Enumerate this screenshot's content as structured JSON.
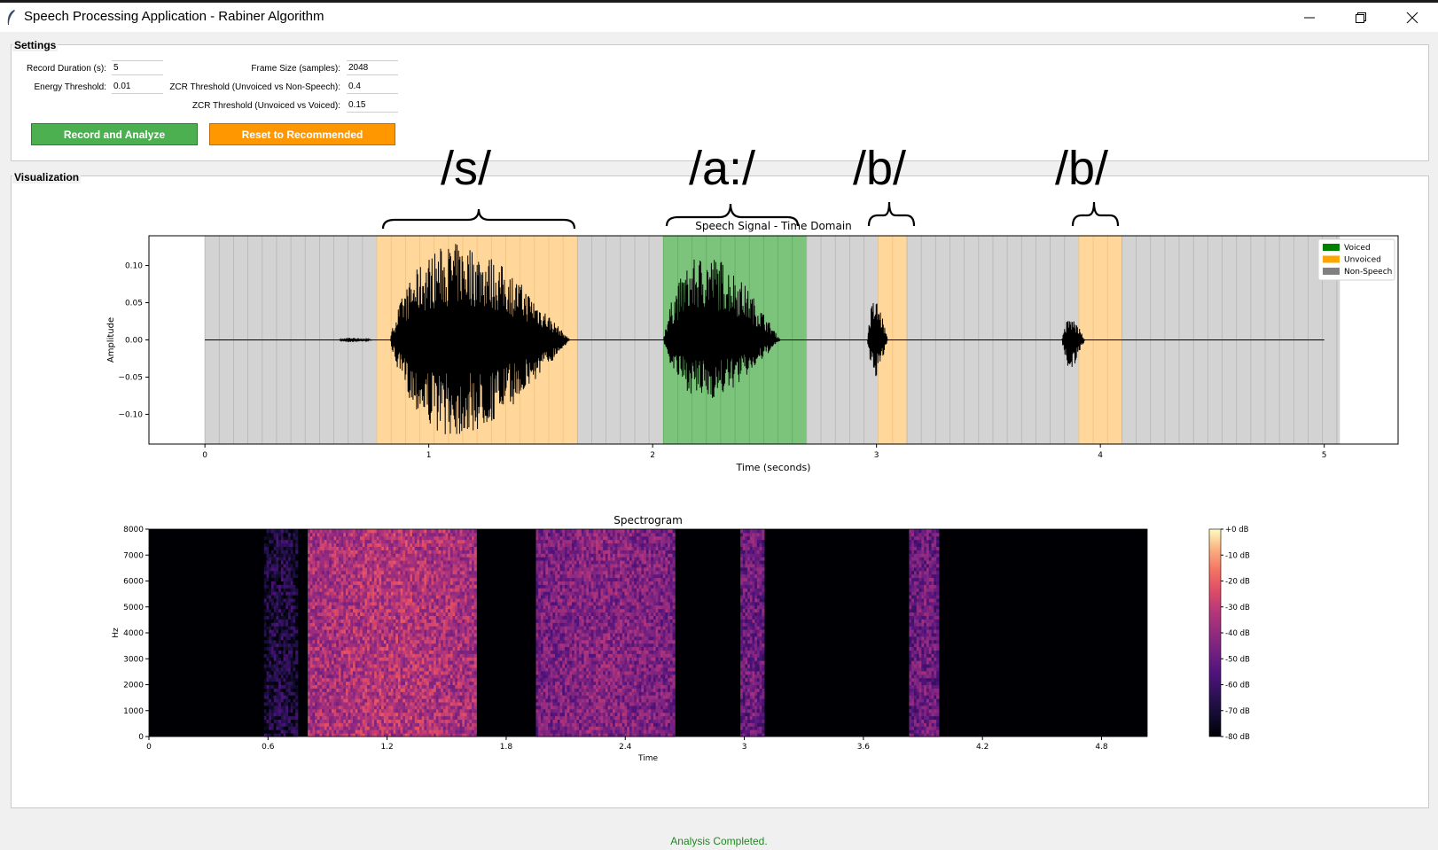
{
  "window": {
    "title": "Speech Processing Application - Rabiner Algorithm",
    "controls": [
      "minimize-icon",
      "restore-icon",
      "close-icon"
    ]
  },
  "settings": {
    "group_label": "Settings",
    "fields": {
      "record_duration": {
        "label": "Record Duration (s):",
        "value": "5"
      },
      "frame_size": {
        "label": "Frame Size (samples):",
        "value": "2048"
      },
      "energy_threshold": {
        "label": "Energy Threshold:",
        "value": "0.01"
      },
      "zcr_unvoiced_nonspeech": {
        "label": "ZCR Threshold (Unvoiced vs Non-Speech):",
        "value": "0.4"
      },
      "zcr_unvoiced_voiced": {
        "label": "ZCR Threshold (Unvoiced vs Voiced):",
        "value": "0.15"
      }
    },
    "buttons": {
      "record": "Record and Analyze",
      "reset": "Reset to Recommended"
    }
  },
  "visualization": {
    "group_label": "Visualization",
    "annotations": [
      "/s/",
      "/a:/",
      "/b/",
      "/b/"
    ]
  },
  "status": "Analysis Completed.",
  "colors": {
    "voiced": "#008000",
    "unvoiced": "#ffa500",
    "non_speech": "#808080",
    "record_button": "#4caf50",
    "reset_button": "#ff9800",
    "status_text": "#1e8a1e"
  },
  "chart_data": [
    {
      "type": "line",
      "title": "Speech Signal - Time Domain",
      "xlabel": "Time (seconds)",
      "ylabel": "Amplitude",
      "xlim": [
        -0.25,
        5.33
      ],
      "ylim": [
        -0.14,
        0.14
      ],
      "xticks": [
        0,
        1,
        2,
        3,
        4,
        5
      ],
      "yticks": [
        0.1,
        0.05,
        0.0,
        -0.05,
        -0.1
      ],
      "ytick_labels": [
        "0.10",
        "0.05",
        "0.00",
        "−0.05",
        "−0.10"
      ],
      "legend": {
        "position": "top-right",
        "entries": [
          {
            "label": "Voiced",
            "color": "#008000"
          },
          {
            "label": "Unvoiced",
            "color": "#ffa500"
          },
          {
            "label": "Non-Speech",
            "color": "#808080"
          }
        ]
      },
      "frame_span": [
        0,
        5.07
      ],
      "frame_step": 0.064,
      "segments": [
        {
          "class": "Unvoiced",
          "start": 0.79,
          "end": 1.65
        },
        {
          "class": "Voiced",
          "start": 2.04,
          "end": 2.7
        },
        {
          "class": "Unvoiced",
          "start": 3.03,
          "end": 3.16
        },
        {
          "class": "Unvoiced",
          "start": 3.88,
          "end": 4.08
        }
      ],
      "bursts": [
        {
          "start": 0.6,
          "end": 0.75,
          "amp_pos": 0.003,
          "amp_neg": 0.003
        },
        {
          "start": 0.83,
          "end": 1.63,
          "amp_pos": 0.13,
          "amp_neg": 0.13
        },
        {
          "start": 2.05,
          "end": 2.57,
          "amp_pos": 0.115,
          "amp_neg": 0.08
        },
        {
          "start": 2.96,
          "end": 3.05,
          "amp_pos": 0.055,
          "amp_neg": 0.05
        },
        {
          "start": 3.83,
          "end": 3.93,
          "amp_pos": 0.03,
          "amp_neg": 0.04
        }
      ]
    },
    {
      "type": "heatmap",
      "title": "Spectrogram",
      "xlabel": "Time",
      "ylabel": "Hz",
      "xlim": [
        0,
        5.03
      ],
      "ylim": [
        0,
        8000
      ],
      "xticks": [
        0,
        0.6,
        1.2,
        1.8,
        2.4,
        3,
        3.6,
        4.2,
        4.8
      ],
      "xtick_labels": [
        "0",
        "0.6",
        "1.2",
        "1.8",
        "2.4",
        "3",
        "3.6",
        "4.2",
        "4.8"
      ],
      "yticks": [
        0,
        1000,
        2000,
        3000,
        4000,
        5000,
        6000,
        7000,
        8000
      ],
      "colorbar": {
        "range": [
          -80,
          0
        ],
        "ticks": [
          "+0 dB",
          "-10 dB",
          "-20 dB",
          "-30 dB",
          "-40 dB",
          "-50 dB",
          "-60 dB",
          "-70 dB",
          "-80 dB"
        ]
      },
      "energy_regions": [
        {
          "start": 0.58,
          "end": 0.75,
          "level_db": -55
        },
        {
          "start": 0.8,
          "end": 1.65,
          "level_db": -20
        },
        {
          "start": 1.95,
          "end": 2.65,
          "level_db": -30
        },
        {
          "start": 2.98,
          "end": 3.1,
          "level_db": -35
        },
        {
          "start": 3.83,
          "end": 3.98,
          "level_db": -35
        }
      ]
    }
  ]
}
